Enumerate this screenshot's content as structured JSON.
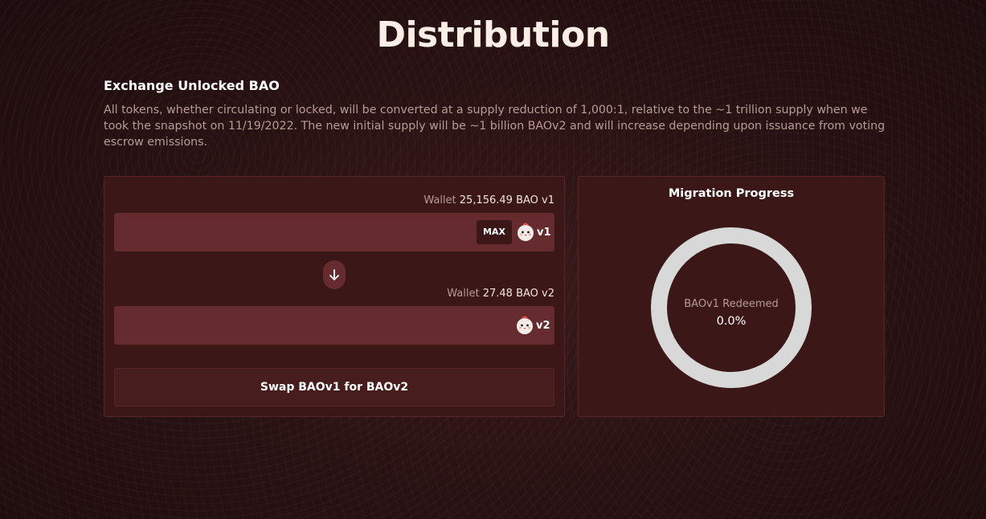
{
  "page": {
    "title": "Distribution"
  },
  "exchange": {
    "heading": "Exchange Unlocked BAO",
    "description": "All tokens, whether circulating or locked, will be converted at a supply reduction of 1,000:1, relative to the ~1 trillion supply when we took the snapshot on 11/19/2022. The new initial supply will be ~1 billion BAOv2 and will increase depending upon issuance from voting escrow emissions."
  },
  "swap": {
    "from": {
      "wallet_label": "Wallet",
      "wallet_amount": "25,156.49 BAO v1",
      "max_label": "MAX",
      "token_label": "v1",
      "input_value": ""
    },
    "to": {
      "wallet_label": "Wallet",
      "wallet_amount": "27.48 BAO v2",
      "token_label": "v2",
      "input_value": ""
    },
    "arrow_icon": "arrow-down-icon",
    "swap_button_label": "Swap BAOv1 for BAOv2"
  },
  "migration": {
    "title": "Migration Progress",
    "center_label": "BAOv1 Redeemed",
    "center_value": "0.0%",
    "progress_fraction": 0.0
  },
  "colors": {
    "background": "#2a1213",
    "card": "#3b1717",
    "field": "#652b2e",
    "ring_track": "#d8d8d8",
    "muted_text": "#b59c95"
  }
}
